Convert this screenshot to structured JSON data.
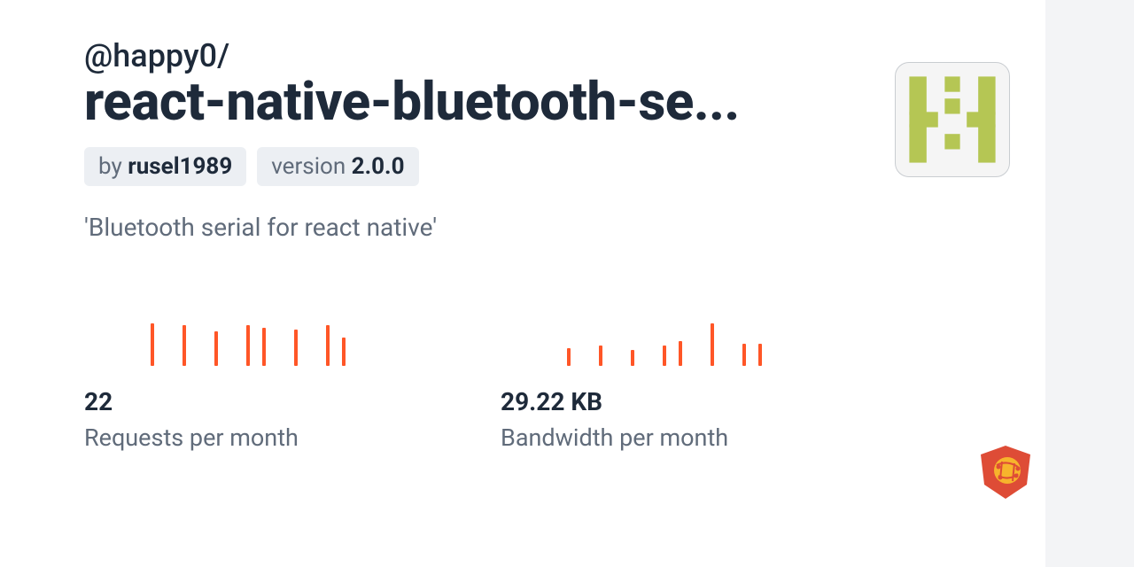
{
  "package": {
    "scope": "@happy0/",
    "name": "react-native-bluetooth-se...",
    "author_prefix": "by ",
    "author": "rusel1989",
    "version_prefix": "version ",
    "version": "2.0.0",
    "description": "'Bluetooth serial for react native'"
  },
  "stats": {
    "requests": {
      "value": "22",
      "label": "Requests per month"
    },
    "bandwidth": {
      "value": "29.22 KB",
      "label": "Bandwidth per month"
    }
  },
  "chart_data": [
    {
      "type": "bar",
      "title": "Requests per month",
      "values": [
        42,
        0,
        40,
        0,
        34,
        0,
        40,
        38,
        0,
        36,
        0,
        40,
        28
      ]
    },
    {
      "type": "bar",
      "title": "Bandwidth per month",
      "values": [
        16,
        0,
        18,
        0,
        14,
        0,
        18,
        22,
        0,
        38,
        0,
        20,
        20
      ]
    }
  ],
  "colors": {
    "accent": "#ff5627",
    "text_dark": "#1e2a3a",
    "text_muted": "#606b7a",
    "badge_bg": "#eceff3",
    "avatar_fg": "#b5c654"
  }
}
